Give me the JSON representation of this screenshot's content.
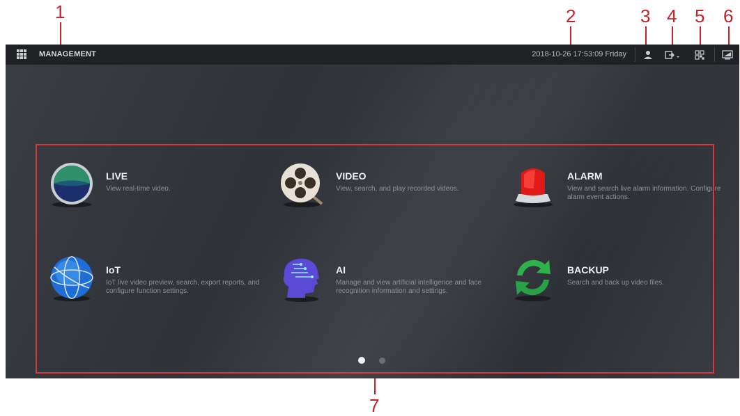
{
  "callouts": [
    "1",
    "2",
    "3",
    "4",
    "5",
    "6",
    "7"
  ],
  "header": {
    "title": "MANAGEMENT",
    "datetime": "2018-10-26 17:53:09 Friday"
  },
  "icons": {
    "menu": "grid-menu-icon",
    "user": "user-icon",
    "logout": "logout-icon",
    "qr": "qr-code-icon",
    "display": "display-icon"
  },
  "tiles": [
    {
      "name": "LIVE",
      "desc": "View real-time video."
    },
    {
      "name": "VIDEO",
      "desc": "View, search, and play recorded videos."
    },
    {
      "name": "ALARM",
      "desc": "View and search live alarm information. Configure alarm event actions."
    },
    {
      "name": "IoT",
      "desc": "IoT live video preview, search, export reports, and configure function settings."
    },
    {
      "name": "AI",
      "desc": "Manage and view artificial intelligence and face recognition information and settings."
    },
    {
      "name": "BACKUP",
      "desc": "Search and back up video files."
    }
  ],
  "pagination": {
    "current": 1,
    "total": 2
  },
  "colors": {
    "callout": "#c8202a",
    "frame": "#d23a40",
    "topbar": "#1f2125"
  }
}
